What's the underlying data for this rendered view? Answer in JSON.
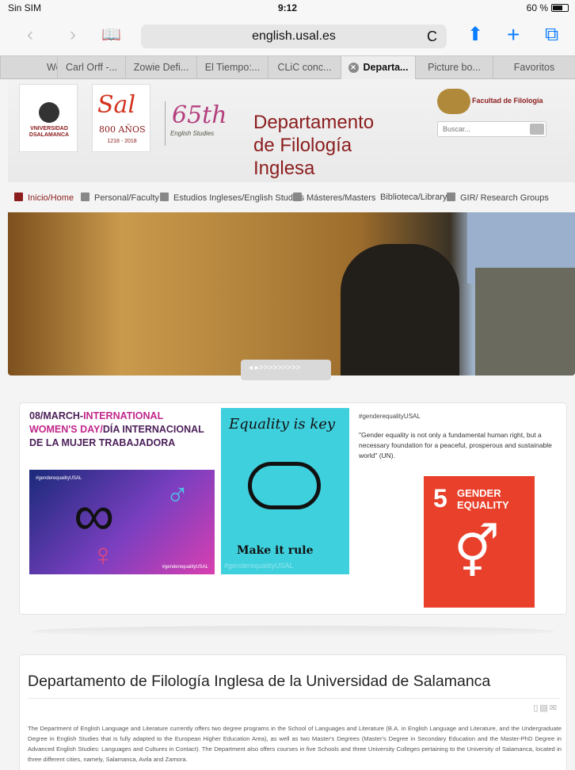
{
  "status": {
    "carrier": "Sin SIM",
    "time": "9:12",
    "battery": "60 %"
  },
  "toolbar": {
    "back": "‹",
    "forward": "›",
    "bookmarks": "📖",
    "url": "english.usal.es",
    "reload": "C",
    "share": "⬆",
    "new_tab": "+",
    "tabs": "⧉"
  },
  "tabs": [
    {
      "label": "Wo"
    },
    {
      "label": "Carl Orff -..."
    },
    {
      "label": "Zowie Defi..."
    },
    {
      "label": "El Tiempo:..."
    },
    {
      "label": "CLiC conc..."
    },
    {
      "label": "Departa...",
      "active": true
    },
    {
      "label": "Picture bo..."
    },
    {
      "label": "Favoritos"
    }
  ],
  "header": {
    "usal_text": "VNIVERSIDAD DSALAMANCA",
    "eight_hundred": "Sal",
    "eight_hundred_sub": "800 AÑOS",
    "eight_hundred_years": "1218 - 2018",
    "sixty": "65th",
    "sixty_sub": "English Studies",
    "title_l1": "Departamento",
    "title_l2": "de Filología",
    "title_l3": "Inglesa",
    "faculty": "Facultad de Filología",
    "search_placeholder": "Buscar..."
  },
  "nav": [
    "Inicio/Home",
    "Personal/Faculty",
    "Estudios Ingleses/English Studies",
    "Másteres/Masters",
    "Biblioteca/Library",
    "GIR/ Research Groups"
  ],
  "slider": {
    "label": "◂ ▸>>>>>>>>>"
  },
  "banner": {
    "head_a": "08/MARCH-",
    "head_b": "INTERNATIONAL",
    "head_c": "WOMEN'S DAY/",
    "head_d": "DÍA INTERNACIONAL DE LA MUJER TRABAJADORA",
    "purple_tag": "#genderequalityUSAL",
    "purple_tag2": "#genderequalityUSAL",
    "equality": "Equality is key",
    "make_it": "Make it rule",
    "teal_tag": "#genderequalityUSAL",
    "hashtag": "#genderequalityUSAL",
    "quote": "\"Gender equality is not only a fundamental human right, but a necessary foundation for a peaceful, prosperous and sustainable world\" (UN).",
    "sdg_num": "5",
    "sdg_l1": "GENDER",
    "sdg_l2": "EQUALITY"
  },
  "article": {
    "title": "Departamento de Filología Inglesa de la Universidad de Salamanca",
    "body": "The Department of English Language and Literature currently offers two degree programs in the School of Languages and Literature (B.A. in English Language and Literature, and the Undergraduate Degree in English Studies that is fully adapted to the European Higher Education Area), as well as two Master's Degrees (Master's Degree in Secondary Education and the Master-PhD Degree in Advanced English Studies: Languages and Cultures in Contact). The Department also offers courses in five Schools and three University Colleges pertaining to the University of Salamanca, located in three different cities, namely, Salamanca, Avila and Zamora."
  }
}
